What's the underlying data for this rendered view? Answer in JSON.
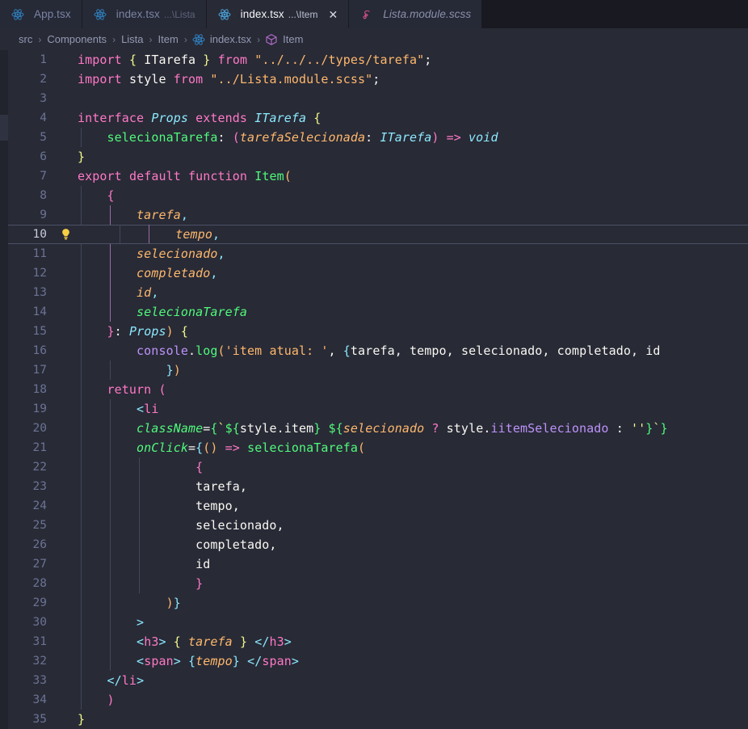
{
  "window": {
    "app": "code-editor",
    "theme_background": "#282a36",
    "tabbar_background": "#191a21"
  },
  "tabs": [
    {
      "id": "app-tsx",
      "icon": "react-icon",
      "name": "App.tsx",
      "desc": "",
      "active": false,
      "closable": false,
      "italic": false
    },
    {
      "id": "index-lista",
      "icon": "react-icon",
      "name": "index.tsx",
      "desc": "...\\Lista",
      "active": false,
      "closable": false,
      "italic": false
    },
    {
      "id": "index-item",
      "icon": "react-icon",
      "name": "index.tsx",
      "desc": "...\\Item",
      "active": true,
      "closable": true,
      "italic": false,
      "close_label": "✕"
    },
    {
      "id": "lista-scss",
      "icon": "scss-icon",
      "name": "Lista.module.scss",
      "desc": "",
      "active": false,
      "closable": false,
      "italic": true
    }
  ],
  "breadcrumb": {
    "separator": "›",
    "items": [
      {
        "label": "src",
        "icon": null
      },
      {
        "label": "Components",
        "icon": null
      },
      {
        "label": "Lista",
        "icon": null
      },
      {
        "label": "Item",
        "icon": null
      },
      {
        "label": "index.tsx",
        "icon": "react-icon"
      },
      {
        "label": "Item",
        "icon": "symbol-cube-icon"
      }
    ]
  },
  "editor": {
    "current_line": 10,
    "first_line": 1,
    "last_line": 35,
    "gutter_hint_icon": "lightbulb-icon",
    "colors": {
      "background": "#282a36",
      "line_number": "#6b7394",
      "line_number_active": "#c7cbdb",
      "current_line_border": "#4b5066",
      "indent_guide": "#434758",
      "indent_guide_active": "#9a6ea3",
      "keyword": "#ff79c6",
      "function": "#50fa7b",
      "type": "#8be9fd",
      "string": "#ffb86c",
      "property": "#bd93f9",
      "foreground": "#f8f8f2",
      "brace_yellow": "#f1fa8c"
    },
    "lines": [
      {
        "n": 1,
        "text": "import { ITarefa } from \"../../../types/tarefa\";"
      },
      {
        "n": 2,
        "text": "import style from \"../Lista.module.scss\";"
      },
      {
        "n": 3,
        "text": ""
      },
      {
        "n": 4,
        "text": "interface Props extends ITarefa {"
      },
      {
        "n": 5,
        "text": "    selecionaTarefa: (tarefaSelecionada: ITarefa) => void"
      },
      {
        "n": 6,
        "text": "}"
      },
      {
        "n": 7,
        "text": "export default function Item("
      },
      {
        "n": 8,
        "text": "    {"
      },
      {
        "n": 9,
        "text": "        tarefa,"
      },
      {
        "n": 10,
        "text": "        tempo,"
      },
      {
        "n": 11,
        "text": "        selecionado,"
      },
      {
        "n": 12,
        "text": "        completado,"
      },
      {
        "n": 13,
        "text": "        id,"
      },
      {
        "n": 14,
        "text": "        selecionaTarefa"
      },
      {
        "n": 15,
        "text": "    }: Props) {"
      },
      {
        "n": 16,
        "text": "        console.log('item atual: ', {tarefa, tempo, selecionado, completado, id"
      },
      {
        "n": 17,
        "text": "            })"
      },
      {
        "n": 18,
        "text": "    return ("
      },
      {
        "n": 19,
        "text": "        <li"
      },
      {
        "n": 20,
        "text": "        className={`${style.item} ${selecionado ? style.iitemSelecionado : ''}`}"
      },
      {
        "n": 21,
        "text": "        onClick={() => selecionaTarefa("
      },
      {
        "n": 22,
        "text": "                {"
      },
      {
        "n": 23,
        "text": "                tarefa,"
      },
      {
        "n": 24,
        "text": "                tempo,"
      },
      {
        "n": 25,
        "text": "                selecionado,"
      },
      {
        "n": 26,
        "text": "                completado,"
      },
      {
        "n": 27,
        "text": "                id"
      },
      {
        "n": 28,
        "text": "                }"
      },
      {
        "n": 29,
        "text": "            )}"
      },
      {
        "n": 30,
        "text": "        >"
      },
      {
        "n": 31,
        "text": "        <h3> { tarefa } </h3>"
      },
      {
        "n": 32,
        "text": "        <span> {tempo} </span>"
      },
      {
        "n": 33,
        "text": "    </li>"
      },
      {
        "n": 34,
        "text": "    )"
      },
      {
        "n": 35,
        "text": "}"
      }
    ]
  }
}
